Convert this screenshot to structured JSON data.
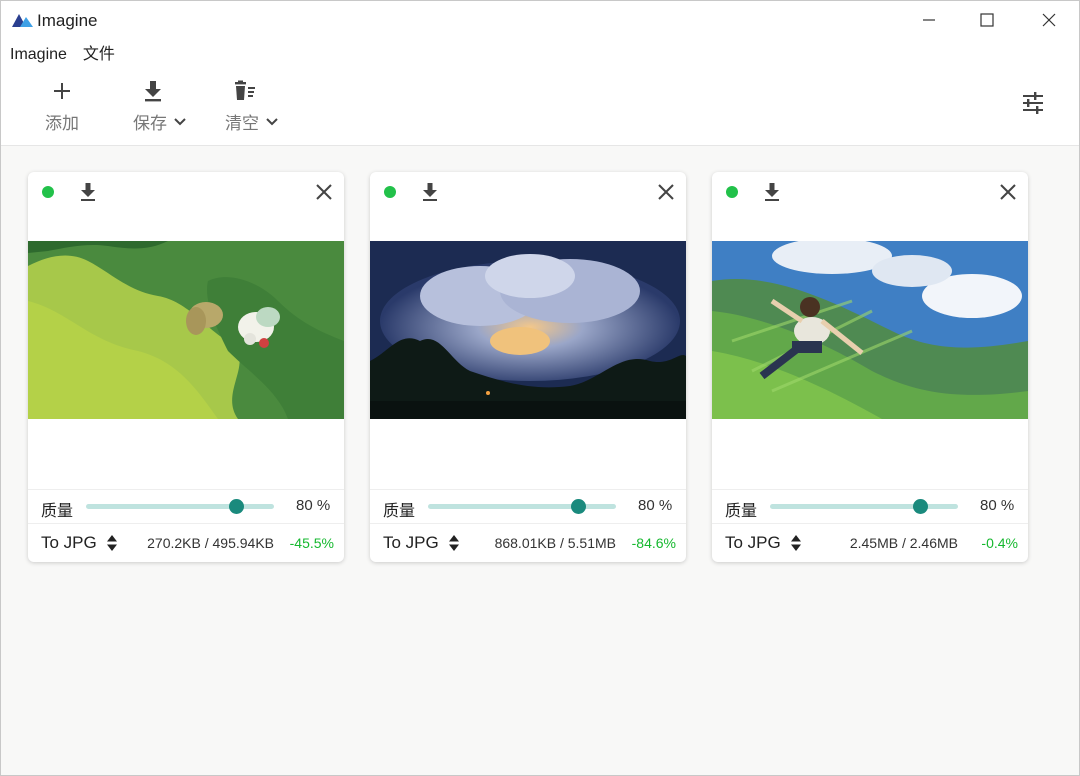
{
  "window": {
    "title": "Imagine",
    "logo_colors": [
      "#2a3f8f",
      "#3ea0e6"
    ]
  },
  "menu": [
    {
      "label": "Imagine"
    },
    {
      "label": "文件"
    }
  ],
  "toolbar": {
    "add_label": "添加",
    "save_label": "保存",
    "clear_label": "清空",
    "settings_icon": "sliders-icon"
  },
  "colors": {
    "accent": "#1a8a7d",
    "track": "#bfe3df",
    "status_ok": "#22c14a",
    "saving_green": "#16b82f"
  },
  "cards": [
    {
      "status": "done",
      "quality_label": "质量",
      "quality": 80,
      "quality_text": "80 %",
      "format": "To JPG",
      "sizes": "270.2KB / 495.94KB",
      "ratio": "-45.5%"
    },
    {
      "status": "done",
      "quality_label": "质量",
      "quality": 80,
      "quality_text": "80 %",
      "format": "To JPG",
      "sizes": "868.01KB / 5.51MB",
      "ratio": "-84.6%"
    },
    {
      "status": "done",
      "quality_label": "质量",
      "quality": 80,
      "quality_text": "80 %",
      "format": "To JPG",
      "sizes": "2.45MB / 2.46MB",
      "ratio": "-0.4%"
    }
  ]
}
